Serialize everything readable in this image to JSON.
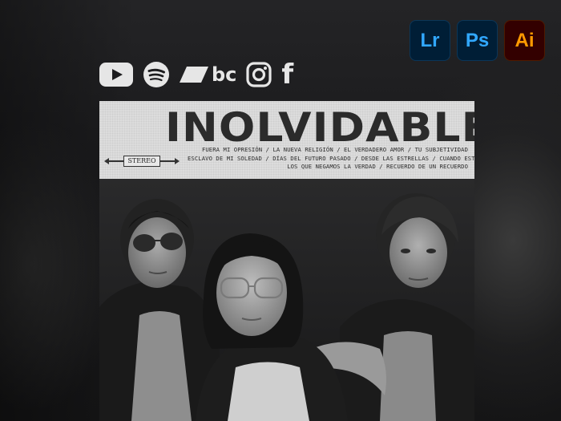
{
  "app_badges": [
    {
      "label": "Lr",
      "name": "lightroom-badge"
    },
    {
      "label": "Ps",
      "name": "photoshop-badge"
    },
    {
      "label": "Ai",
      "name": "illustrator-badge"
    }
  ],
  "socials": [
    {
      "icon": "youtube-icon"
    },
    {
      "icon": "spotify-icon"
    },
    {
      "icon": "bandcamp-icon",
      "text": "bc"
    },
    {
      "icon": "instagram-icon"
    },
    {
      "icon": "facebook-icon",
      "text": "f"
    }
  ],
  "poster": {
    "title": "INOLVIDABLE",
    "stereo_label": "STEREO",
    "tracklist": [
      "FUERA MI OPRESIÓN / LA NUEVA RELIGIÓN / EL VERDADERO AMOR / TU SUBJETIVIDAD",
      "ESCLAVO DE MI SOLEDAD / DÍAS DEL FUTURO PASADO / DESDE LAS ESTRELLAS / CUANDO ESTÁS AQUÍ",
      "LOS QUE NEGAMOS LA VERDAD / RECUERDO DE UN RECUERDO"
    ]
  },
  "colors": {
    "background": "#1c1c1e",
    "banner": "#dcdcdc",
    "title_text": "#2b2b2b",
    "lr_ps_fill": "#001e36",
    "lr_ps_text": "#31a8ff",
    "ai_fill": "#330000",
    "ai_text": "#ff9a00",
    "icon_color": "#e6e6e6"
  }
}
